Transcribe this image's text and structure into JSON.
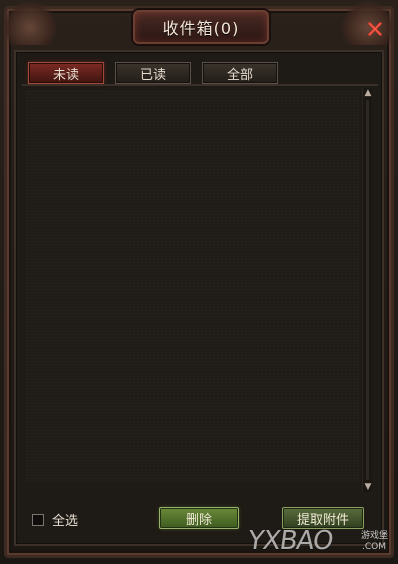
{
  "window": {
    "title": "收件箱(0)"
  },
  "tabs": [
    {
      "label": "未读",
      "active": true
    },
    {
      "label": "已读",
      "active": false
    },
    {
      "label": "全部",
      "active": false
    }
  ],
  "mail_list": {
    "items": []
  },
  "footer": {
    "select_all_label": "全选",
    "select_all_checked": false,
    "delete_label": "删除",
    "claim_attachments_label": "提取附件"
  },
  "icons": {
    "close": "close-icon",
    "scroll_up": "chevron-up-icon",
    "scroll_down": "chevron-down-icon"
  },
  "colors": {
    "title_text": "#f2e6d6",
    "active_tab": "#7b2b24",
    "button_green": "#6b8a3b",
    "close_icon": "#e13a2b"
  },
  "watermark": {
    "brand": "YXBAO",
    "site_cn": "游戏堡",
    "domain": ".COM"
  }
}
